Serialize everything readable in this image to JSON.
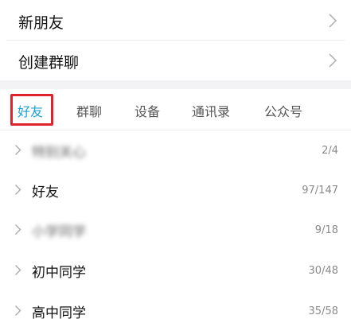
{
  "top_rows": {
    "new_friends": "新朋友",
    "create_group": "创建群聊"
  },
  "tabs": [
    {
      "label": "好友",
      "active": true
    },
    {
      "label": "群聊",
      "active": false
    },
    {
      "label": "设备",
      "active": false
    },
    {
      "label": "通讯录",
      "active": false
    },
    {
      "label": "公众号",
      "active": false
    }
  ],
  "groups": [
    {
      "name": "特别关心",
      "count": "2/4",
      "blurred": true
    },
    {
      "name": "好友",
      "count": "97/147",
      "blurred": false
    },
    {
      "name": "小学同学",
      "count": "9/18",
      "blurred": true
    },
    {
      "name": "初中同学",
      "count": "30/48",
      "blurred": false
    },
    {
      "name": "高中同学",
      "count": "35/58",
      "blurred": false
    }
  ],
  "colors": {
    "active_tab": "#1aa1d6",
    "highlight_box": "#e0232a",
    "section_gap": "#f3f3f5"
  }
}
